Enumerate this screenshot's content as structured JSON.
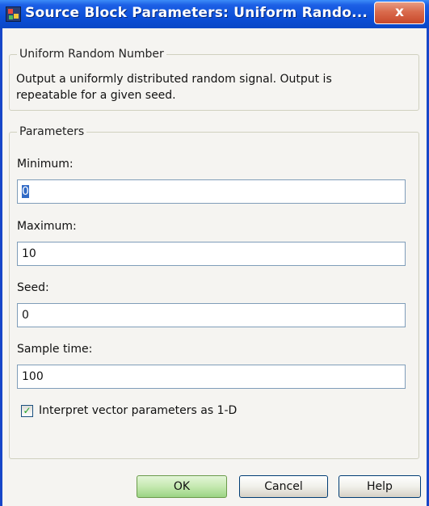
{
  "window": {
    "title": "Source Block Parameters: Uniform Rando...",
    "close_label": "x"
  },
  "block": {
    "name": "Uniform Random Number",
    "description": "Output a uniformly distributed random signal.  Output is repeatable for a given seed."
  },
  "parameters": {
    "legend": "Parameters",
    "minimum": {
      "label": "Minimum:",
      "value": "0"
    },
    "maximum": {
      "label": "Maximum:",
      "value": "10"
    },
    "seed": {
      "label": "Seed:",
      "value": "0"
    },
    "sample_time": {
      "label": "Sample time:",
      "value": "100"
    },
    "interpret_vector": {
      "label": "Interpret vector parameters as 1-D",
      "checked": true
    }
  },
  "buttons": {
    "ok": "OK",
    "cancel": "Cancel",
    "help": "Help"
  },
  "colors": {
    "titlebar": "#0c4fd8",
    "close": "#c8482a",
    "ok_button": "#c5e9b0"
  }
}
